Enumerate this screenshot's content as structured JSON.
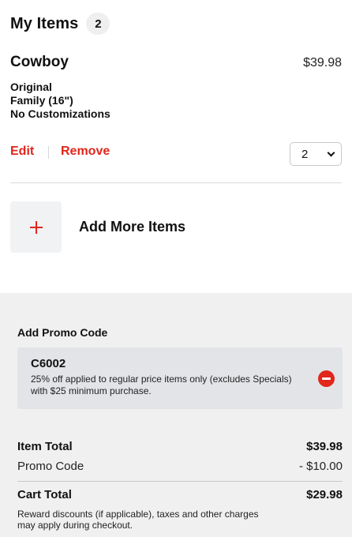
{
  "header": {
    "title": "My Items",
    "count": "2"
  },
  "item": {
    "name": "Cowboy",
    "price": "$39.98",
    "details": [
      "Original",
      "Family (16\")",
      "No Customizations"
    ],
    "edit_label": "Edit",
    "remove_label": "Remove",
    "quantity": "2"
  },
  "add_more": {
    "label": "Add More Items",
    "icon": "plus-icon"
  },
  "promo": {
    "heading": "Add Promo Code",
    "code": "C6002",
    "description": "25% off applied to regular price items only (excludes Specials) with $25 minimum purchase.",
    "remove_icon": "minus-circle-icon"
  },
  "totals": {
    "item_total_label": "Item Total",
    "item_total_value": "$39.98",
    "promo_label": "Promo Code",
    "promo_value": "- $10.00",
    "cart_total_label": "Cart Total",
    "cart_total_value": "$29.98",
    "footnote": "Reward discounts (if applicable), taxes and other charges may apply during checkout."
  },
  "colors": {
    "accent": "#e1261c",
    "summary_bg": "#f0f0f0",
    "promo_card_bg": "#e2e4e7"
  }
}
